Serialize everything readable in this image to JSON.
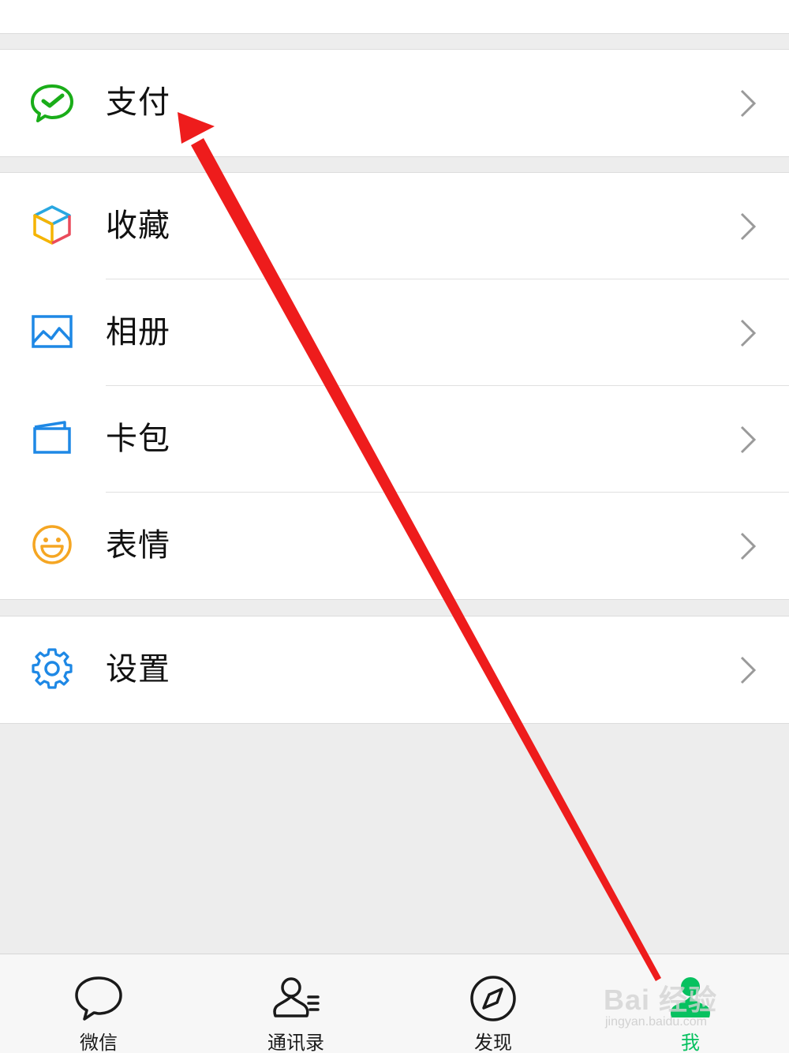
{
  "menu": {
    "groups": [
      {
        "items": [
          {
            "label": "支付",
            "icon": "wechat-pay-icon"
          }
        ]
      },
      {
        "items": [
          {
            "label": "收藏",
            "icon": "favorites-cube-icon"
          },
          {
            "label": "相册",
            "icon": "album-picture-icon"
          },
          {
            "label": "卡包",
            "icon": "card-wallet-icon"
          },
          {
            "label": "表情",
            "icon": "smiley-face-icon"
          }
        ]
      },
      {
        "items": [
          {
            "label": "设置",
            "icon": "settings-gear-icon"
          }
        ]
      }
    ],
    "chevron_icon": "chevron-right-icon"
  },
  "tabbar": {
    "tabs": [
      {
        "label": "微信",
        "icon": "chat-bubble-icon",
        "active": false
      },
      {
        "label": "通讯录",
        "icon": "contacts-icon",
        "active": false
      },
      {
        "label": "发现",
        "icon": "compass-icon",
        "active": false
      },
      {
        "label": "我",
        "icon": "me-person-icon",
        "active": true
      }
    ]
  },
  "watermark": {
    "brand": "Bai 经验",
    "url": "jingyan.baidu.com"
  },
  "colors": {
    "accent_green": "#07c160",
    "annotation_red": "#ee1c1c",
    "pay_green": "#1aad19",
    "icon_blue": "#1e88e5",
    "smiley_orange": "#f5a623"
  }
}
